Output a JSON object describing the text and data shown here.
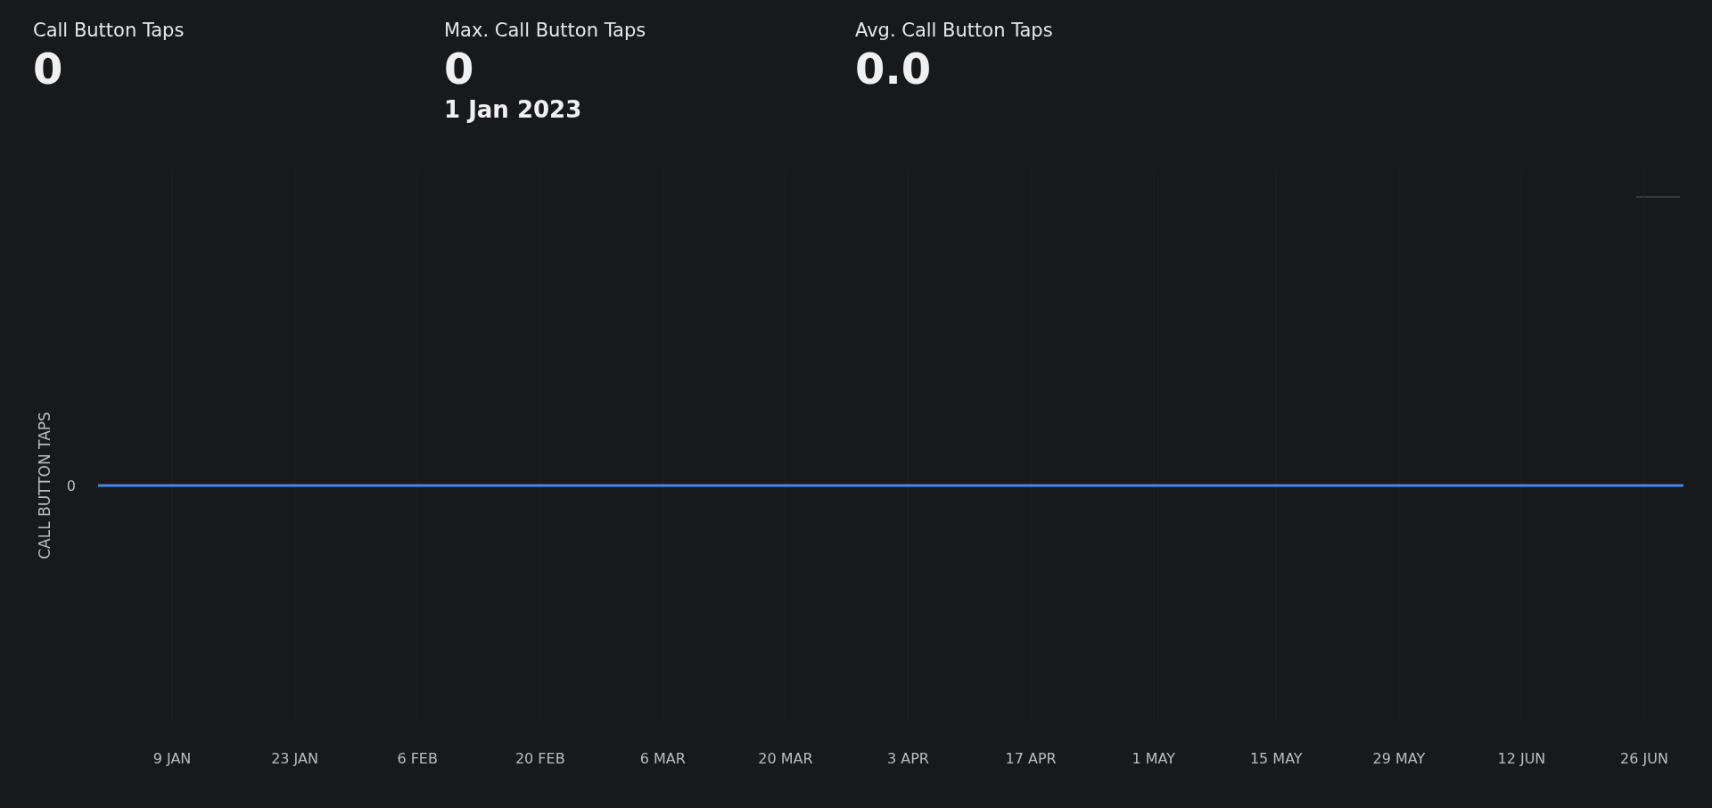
{
  "stats": [
    {
      "label": "Call Button Taps",
      "value": "0"
    },
    {
      "label": "Max. Call Button Taps",
      "value": "0",
      "date": "1 Jan 2023"
    },
    {
      "label": "Avg. Call Button Taps",
      "value": "0.0"
    }
  ],
  "chart": {
    "ylabel": "CALL BUTTON TAPS",
    "y_tick_label": "0",
    "x_labels": [
      "9 JAN",
      "23 JAN",
      "6 FEB",
      "20 FEB",
      "6 MAR",
      "20 MAR",
      "3 APR",
      "17 APR",
      "1 MAY",
      "15 MAY",
      "29 MAY",
      "12 JUN",
      "26 JUN"
    ]
  }
}
